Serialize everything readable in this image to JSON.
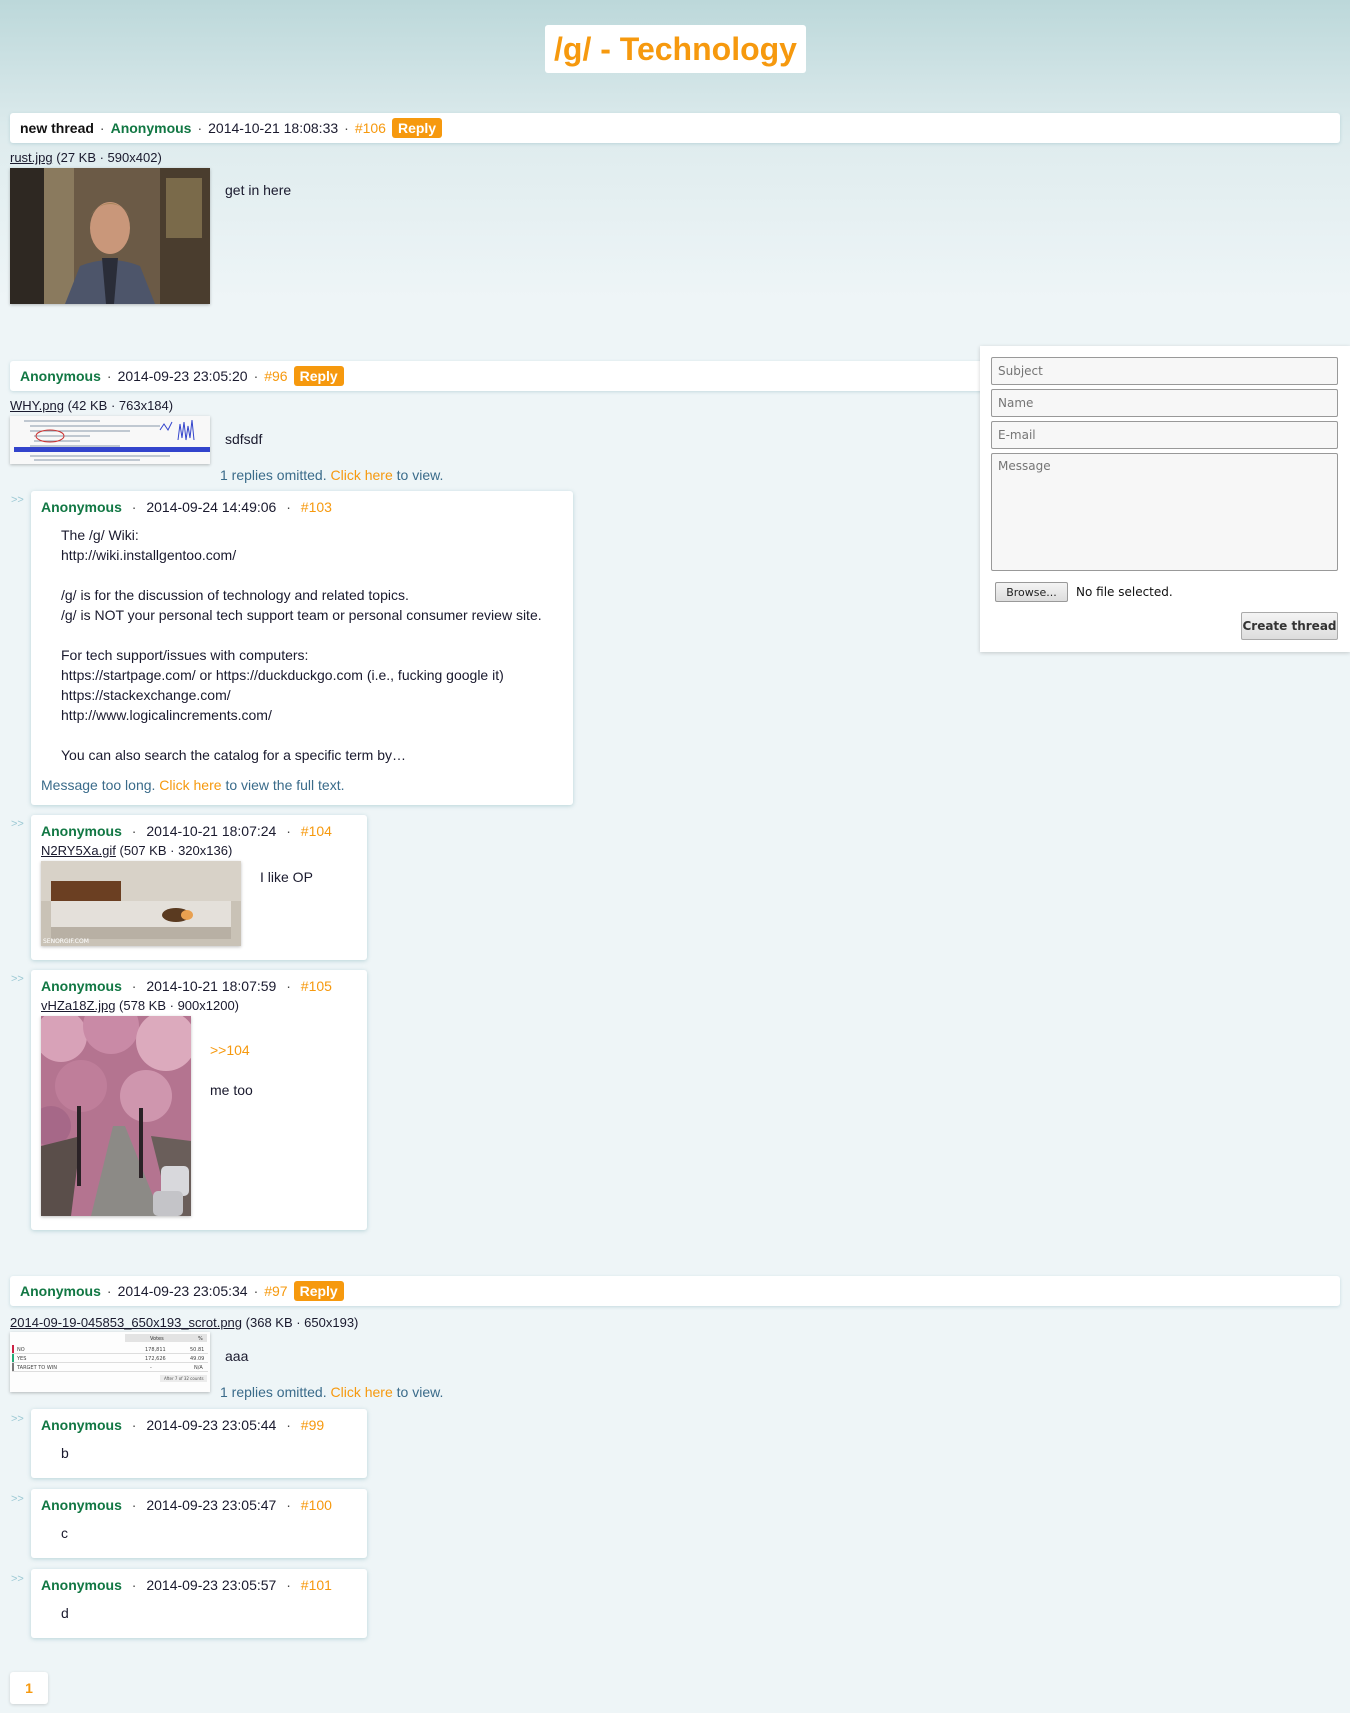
{
  "board": {
    "title": "/g/ - Technology"
  },
  "form": {
    "subject_placeholder": "Subject",
    "name_placeholder": "Name",
    "email_placeholder": "E-mail",
    "message_placeholder": "Message",
    "browse_label": "Browse...",
    "file_status": "No file selected.",
    "submit_label": "Create thread"
  },
  "threads": [
    {
      "subject": "new thread",
      "name": "Anonymous",
      "date": "2014-10-21 18:08:33",
      "postno": "#106",
      "reply_label": "Reply",
      "file": {
        "name": "rust.jpg",
        "meta": "(27 KB · 590x402)"
      },
      "message": "get in here"
    },
    {
      "name": "Anonymous",
      "date": "2014-09-23 23:05:20",
      "postno": "#96",
      "reply_label": "Reply",
      "file": {
        "name": "WHY.png",
        "meta": "(42 KB · 763x184)"
      },
      "message": "sdfsdf",
      "omitted": {
        "prefix": "1 replies omitted.",
        "link": "Click here",
        "suffix": "to view."
      },
      "replies": [
        {
          "name": "Anonymous",
          "date": "2014-09-24 14:49:06",
          "postno": "#103",
          "message": "The /g/ Wiki:\nhttp://wiki.installgentoo.com/\n\n/g/ is for the discussion of technology and related topics.\n/g/ is NOT your personal tech support team or personal consumer review site.\n\nFor tech support/issues with computers:\nhttps://startpage.com/ or https://duckduckgo.com (i.e., fucking google it)\nhttps://stackexchange.com/\nhttp://www.logicalincrements.com/\n\nYou can also search the catalog for a specific term by…",
          "toolong": {
            "prefix": "Message too long.",
            "link": "Click here",
            "suffix": "to view the full text."
          }
        },
        {
          "name": "Anonymous",
          "date": "2014-10-21 18:07:24",
          "postno": "#104",
          "file": {
            "name": "N2RY5Xa.gif",
            "meta": "(507 KB · 320x136)"
          },
          "message": "I like OP"
        },
        {
          "name": "Anonymous",
          "date": "2014-10-21 18:07:59",
          "postno": "#105",
          "file": {
            "name": "vHZa18Z.jpg",
            "meta": "(578 KB · 900x1200)"
          },
          "quote": ">>104",
          "message": "me too"
        }
      ]
    },
    {
      "name": "Anonymous",
      "date": "2014-09-23 23:05:34",
      "postno": "#97",
      "reply_label": "Reply",
      "file": {
        "name": "2014-09-19-045853_650x193_scrot.png",
        "meta": "(368 KB · 650x193)"
      },
      "message": "aaa",
      "omitted": {
        "prefix": "1 replies omitted.",
        "link": "Click here",
        "suffix": "to view."
      },
      "replies": [
        {
          "name": "Anonymous",
          "date": "2014-09-23 23:05:44",
          "postno": "#99",
          "message": "b"
        },
        {
          "name": "Anonymous",
          "date": "2014-09-23 23:05:47",
          "postno": "#100",
          "message": "c"
        },
        {
          "name": "Anonymous",
          "date": "2014-09-23 23:05:57",
          "postno": "#101",
          "message": "d"
        }
      ]
    }
  ],
  "reply_arrow": ">>",
  "dot": "·",
  "pagination": {
    "current": "1"
  },
  "thumb_table": {
    "headers": [
      "Votes",
      "%"
    ],
    "rows": [
      [
        "NO",
        "178,811",
        "50.81"
      ],
      [
        "YES",
        "172,626",
        "49.09"
      ],
      [
        "TARGET TO WIN",
        "-",
        "N/A"
      ]
    ],
    "footer": "After 7 of 32 counts"
  },
  "watermark": "SENORGIF.COM",
  "colors": {
    "accent": "#f6990e",
    "name": "#117743",
    "link_text": "#3a6b8a"
  }
}
